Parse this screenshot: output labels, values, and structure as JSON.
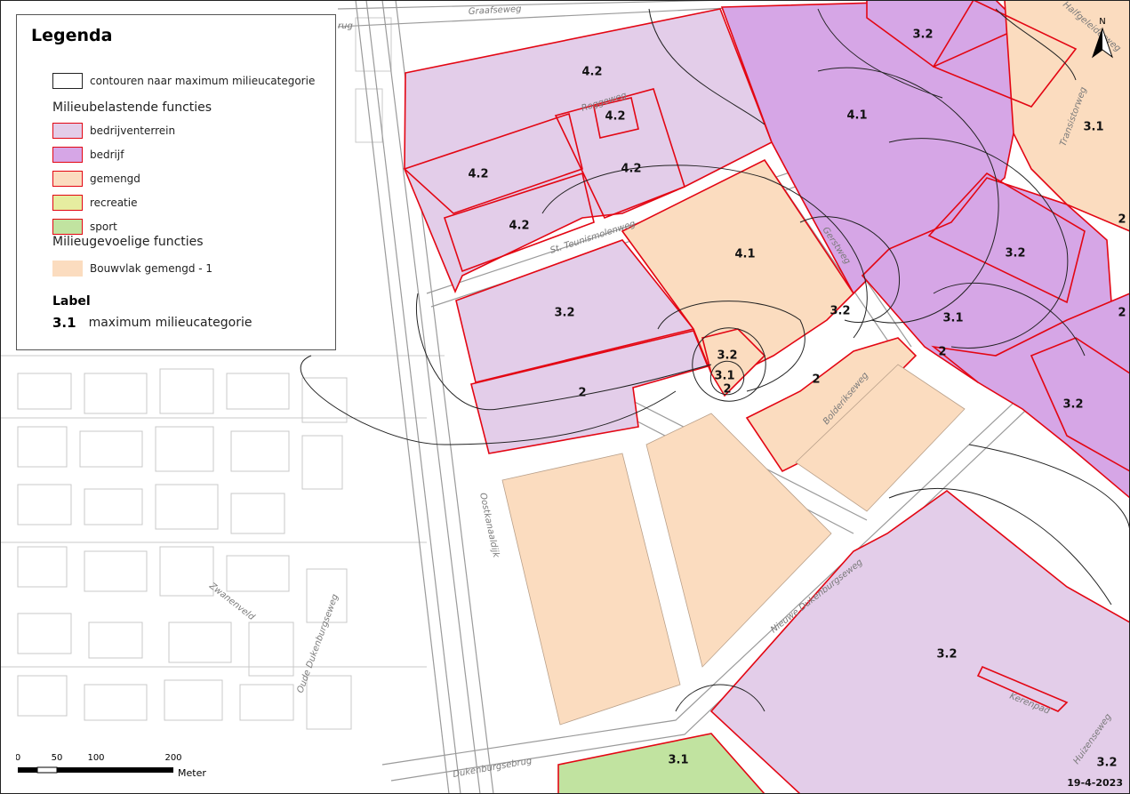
{
  "colors": {
    "bedrijventerrein": "#e3cde9",
    "bedrijf": "#d6a6e6",
    "gemengd": "#fbdcbf",
    "recreatie": "#e6eda0",
    "sport": "#c1e3a0",
    "bouwvlak": "#fbdcbf",
    "zone_border": "#e30613",
    "contour": "#222222",
    "road": "#9a9a9a",
    "building": "#c8c8c8"
  },
  "legend": {
    "title": "Legenda",
    "contour_item": "contouren naar maximum milieucategorie",
    "section_belastend": "Milieubelastende functies",
    "items_belastend": [
      {
        "label": "bedrijventerrein",
        "key": "bedrijventerrein"
      },
      {
        "label": "bedrijf",
        "key": "bedrijf"
      },
      {
        "label": "gemengd",
        "key": "gemengd"
      },
      {
        "label": "recreatie",
        "key": "recreatie"
      },
      {
        "label": "sport",
        "key": "sport"
      }
    ],
    "section_gevoelig": "Milieugevoelige functies",
    "item_gevoelig": "Bouwvlak gemengd - 1",
    "label_title": "Label",
    "label_example": "3.1",
    "label_desc": "maximum milieucategorie"
  },
  "streets": [
    {
      "name": "Graafseweg"
    },
    {
      "name": "Roggeweg"
    },
    {
      "name": "St. Teunismolenweg"
    },
    {
      "name": "Gerstweg"
    },
    {
      "name": "Bolderikseweg"
    },
    {
      "name": "Oostkanaaldijk"
    },
    {
      "name": "Zwanenveld"
    },
    {
      "name": "Oude Dukenburgseweg"
    },
    {
      "name": "Nieuwe Dukenburgseweg"
    },
    {
      "name": "Dukenburgsebrug"
    },
    {
      "name": "Halfgeleiderweg"
    },
    {
      "name": "Transistorweg"
    },
    {
      "name": "Kerenpad"
    },
    {
      "name": "Huizenseweg"
    },
    {
      "name": "rug"
    }
  ],
  "zone_labels": [
    "3.2",
    "4.2",
    "4.2",
    "4.1",
    "3.1",
    "4.2",
    "4.2",
    "4.2",
    "4.1",
    "3.2",
    "3.2",
    "3.2",
    "3.1",
    "3.2",
    "3.1",
    "2",
    "2",
    "2",
    "2",
    "3.2",
    "3.2",
    "3.1",
    "3.2",
    "2",
    "2"
  ],
  "scalebar": {
    "ticks": [
      "0",
      "50",
      "100",
      "200"
    ],
    "unit": "Meter"
  },
  "north_label": "N",
  "date": "19-4-2023"
}
